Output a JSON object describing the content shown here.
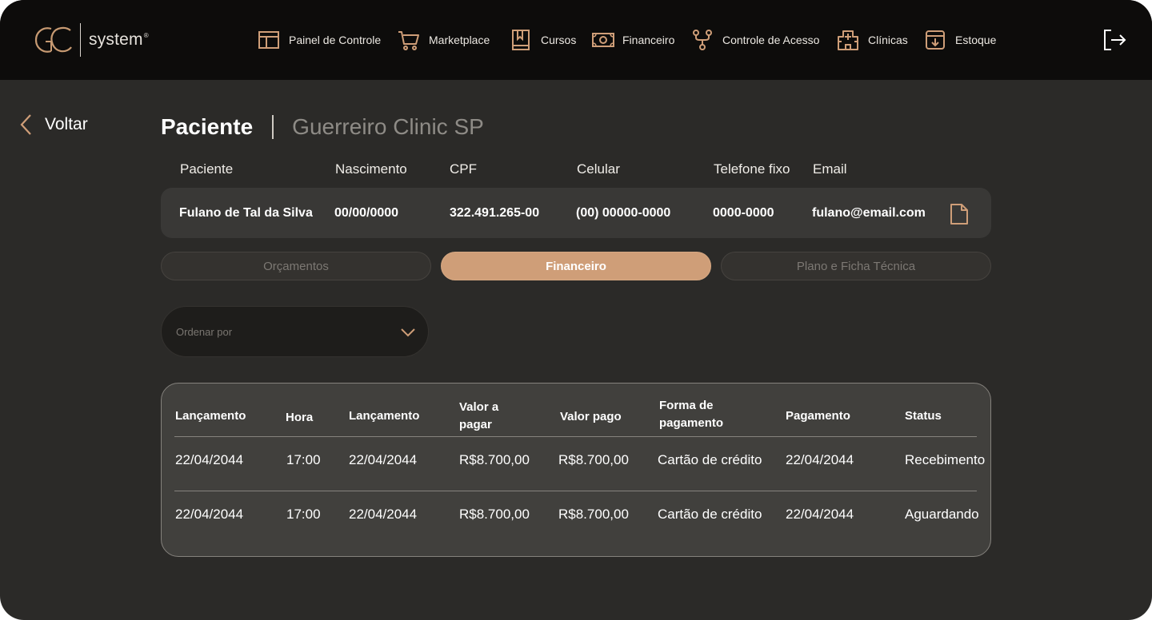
{
  "brand": {
    "logo_text": "system",
    "logo_reg": "®"
  },
  "nav": {
    "items": [
      {
        "label": "Painel de Controle",
        "icon": "dashboard-icon"
      },
      {
        "label": "Marketplace",
        "icon": "cart-icon"
      },
      {
        "label": "Cursos",
        "icon": "book-icon"
      },
      {
        "label": "Financeiro",
        "icon": "money-icon"
      },
      {
        "label": "Controle de Acesso",
        "icon": "access-icon"
      },
      {
        "label": "Clínicas",
        "icon": "hospital-icon"
      },
      {
        "label": "Estoque",
        "icon": "download-box-icon"
      }
    ],
    "logout_icon": "logout-icon"
  },
  "back": {
    "label": "Voltar"
  },
  "page": {
    "title": "Paciente",
    "clinic": "Guerreiro Clinic SP"
  },
  "patient": {
    "headers": {
      "name": "Paciente",
      "birth": "Nascimento",
      "cpf": "CPF",
      "mobile": "Celular",
      "phone": "Telefone fixo",
      "email": "Email"
    },
    "values": {
      "name": "Fulano de Tal da Silva",
      "birth": "00/00/0000",
      "cpf": "322.491.265-00",
      "mobile": "(00) 00000-0000",
      "phone": "0000-0000",
      "email": "fulano@email.com"
    }
  },
  "tabs": [
    {
      "label": "Orçamentos",
      "active": false
    },
    {
      "label": "Financeiro",
      "active": true
    },
    {
      "label": "Plano e Ficha Técnica",
      "active": false
    }
  ],
  "sort": {
    "placeholder": "Ordenar por"
  },
  "table": {
    "headers": [
      "Lançamento",
      "Hora",
      "Lançamento",
      "Valor a pagar",
      "Valor pago",
      "Forma de pagamento",
      "Pagamento",
      "Status"
    ],
    "rows": [
      [
        "22/04/2044",
        "17:00",
        "22/04/2044",
        "R$8.700,00",
        "R$8.700,00",
        "Cartão de crédito",
        "22/04/2044",
        "Recebimento"
      ],
      [
        "22/04/2044",
        "17:00",
        "22/04/2044",
        "R$8.700,00",
        "R$8.700,00",
        "Cartão de crédito",
        "22/04/2044",
        "Aguardando"
      ]
    ]
  },
  "colors": {
    "accent": "#cf9e78",
    "topbar": "#0d0c0b",
    "background": "#2b2a28",
    "card": "#393836",
    "table": "#41403d"
  }
}
